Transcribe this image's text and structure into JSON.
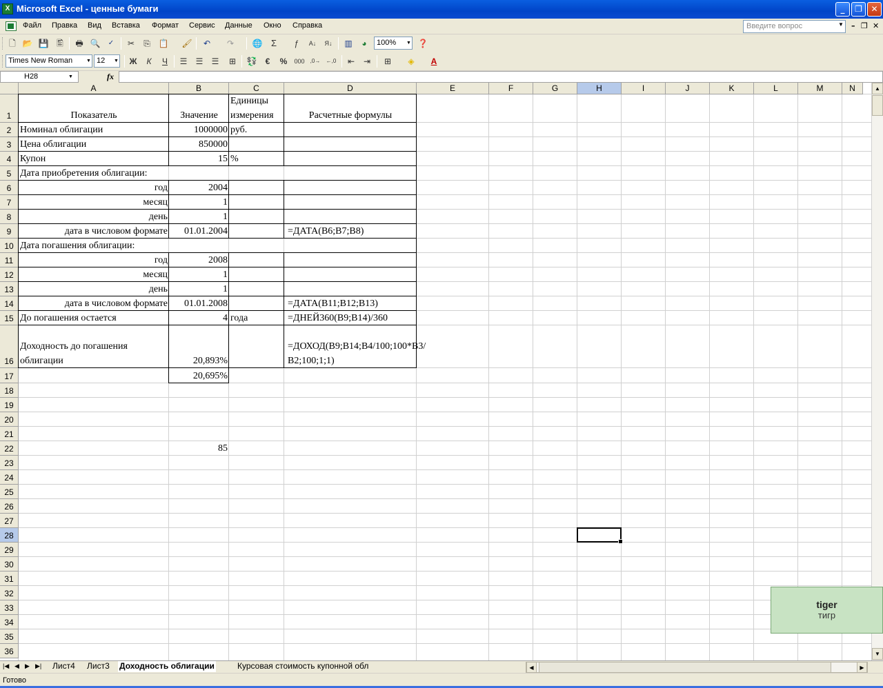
{
  "window": {
    "title": "Microsoft Excel - ценные бумаги",
    "logo_icon": "excel-logo-icon"
  },
  "menu": {
    "items": [
      "Файл",
      "Правка",
      "Вид",
      "Вставка",
      "Формат",
      "Сервис",
      "Данные",
      "Окно",
      "Справка"
    ],
    "help_placeholder": "Введите вопрос"
  },
  "toolbar": {
    "zoom": "100%",
    "font_name": "Times New Roman",
    "font_size": "12"
  },
  "formula_bar": {
    "name_box": "H28",
    "fx": "fx",
    "formula": ""
  },
  "columns": [
    "A",
    "B",
    "C",
    "D",
    "E",
    "F",
    "G",
    "H",
    "I",
    "J",
    "K",
    "L",
    "M",
    "N"
  ],
  "rows": [
    "1",
    "2",
    "3",
    "4",
    "5",
    "6",
    "7",
    "8",
    "9",
    "10",
    "11",
    "12",
    "13",
    "14",
    "15",
    "16",
    "17",
    "18",
    "19",
    "20",
    "21",
    "22",
    "23",
    "24",
    "25",
    "26",
    "27",
    "28",
    "29",
    "30",
    "31",
    "32",
    "33",
    "34",
    "35",
    "36"
  ],
  "selected_cell": "H28",
  "cells": {
    "A1": "Показатель",
    "B1": "Значение",
    "C1": "Единицы измерения",
    "D1": "Расчетные формулы",
    "A2": "Номинал облигации",
    "B2": "1000000",
    "C2": "руб.",
    "A3": "Цена облигации",
    "B3": "850000",
    "A4": "Купон",
    "B4": "15",
    "C4": "%",
    "A5": "Дата приобретения облигации:",
    "A6": "год",
    "B6": "2004",
    "A7": "месяц",
    "B7": "1",
    "A8": "день",
    "B8": "1",
    "A9": "дата в числовом формате",
    "B9": "01.01.2004",
    "D9": "=ДАТА(В6;В7;В8)",
    "A10": "Дата погашения облигации:",
    "A11": "год",
    "B11": "2008",
    "A12": "месяц",
    "B12": "1",
    "A13": "день",
    "B13": "1",
    "A14": "дата в числовом формате",
    "B14": "01.01.2008",
    "D14": "=ДАТА(В11;В12;В13)",
    "A15": "До погашения остается",
    "B15": "4",
    "C15": "года",
    "D15": "=ДНЕЙ360(В9;В14)/360",
    "A16": "Доходность до погашения облигации",
    "B16": "20,893%",
    "D16": "=ДОХОД(В9;В14;В4/100;100*В3/В2;100;1;1)",
    "B17": "20,695%",
    "B22": "85"
  },
  "sheet_tabs": [
    "Лист4",
    "Лист3",
    "Доходность облигации",
    "Курсовая стоимость купонной обл"
  ],
  "active_tab": "Доходность облигации",
  "status": "Готово",
  "popup": {
    "en": "tiger",
    "ru": "тигр"
  }
}
